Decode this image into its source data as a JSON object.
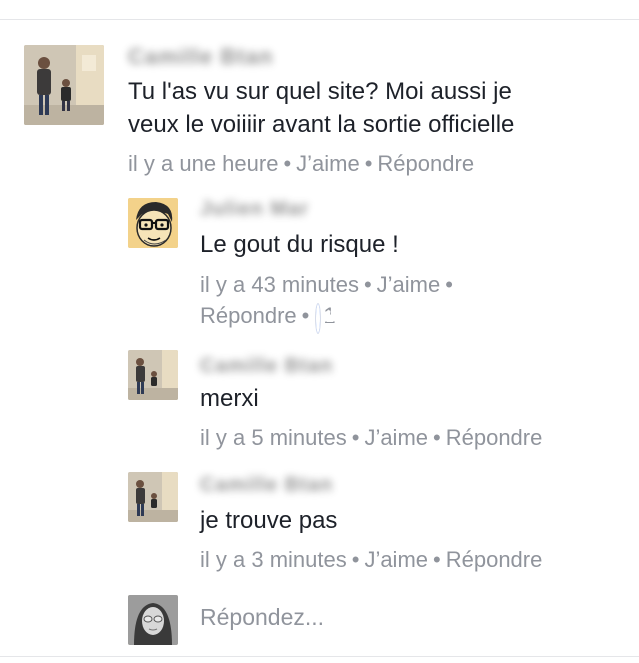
{
  "comments": [
    {
      "author": "Camille Btan",
      "text_lines": [
        "Tu l'as vu sur quel site? Moi aussi je",
        "veux le voiiiir avant la sortie officielle"
      ],
      "time": "il y a une heure",
      "like_label": "J’aime",
      "reply_label": "Répondre"
    }
  ],
  "replies": [
    {
      "author": "Julien Mar",
      "text": "Le gout du risque !",
      "time": "il y a 43 minutes",
      "like_label": "J’aime",
      "reply_label": "Répondre",
      "like_count": "1"
    },
    {
      "author": "Camille Btan",
      "text": "merxi",
      "time": "il y a 5 minutes",
      "like_label": "J’aime",
      "reply_label": "Répondre"
    },
    {
      "author": "Camille Btan",
      "text": "je trouve pas",
      "time": "il y a 3 minutes",
      "like_label": "J’aime",
      "reply_label": "Répondre"
    }
  ],
  "reply_box": {
    "placeholder": "Répondez..."
  },
  "separator": "•",
  "colors": {
    "meta": "#90949c",
    "text": "#1d2129",
    "like_blue": "#4080ff"
  },
  "icons": [
    "thumbs-up-icon"
  ]
}
